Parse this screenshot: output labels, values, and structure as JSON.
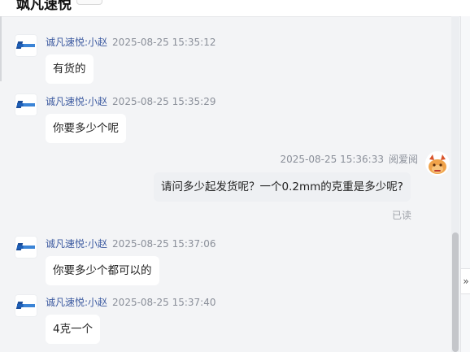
{
  "header": {
    "title": "飒凡速悦"
  },
  "messages": [
    {
      "sender": "诚凡速悦:小赵",
      "time": "2025-08-25 15:35:12",
      "text": "有货的"
    },
    {
      "sender": "诚凡速悦:小赵",
      "time": "2025-08-25 15:35:29",
      "text": "你要多少个呢"
    },
    {
      "sender": "阅爱阅",
      "time": "2025-08-25 15:36:33",
      "text": "请问多少起发货呢？一个0.2mm的克重是多少呢?",
      "status": "已读"
    },
    {
      "sender": "诚凡速悦:小赵",
      "time": "2025-08-25 15:37:06",
      "text": "你要多少个都可以的"
    },
    {
      "sender": "诚凡速悦:小赵",
      "time": "2025-08-25 15:37:40",
      "text": "4克一个"
    }
  ],
  "icons": {
    "shop_avatar": "brand-logo-icon",
    "user_avatar": "cartoon-character-icon",
    "collapse": "double-chevron-right-icon"
  },
  "collapse_glyph": "»",
  "colors": {
    "sender": "#3c5aa0",
    "time": "#8a8f99",
    "my_bubble": "#eef0f3",
    "background": "#f3f4f6"
  }
}
